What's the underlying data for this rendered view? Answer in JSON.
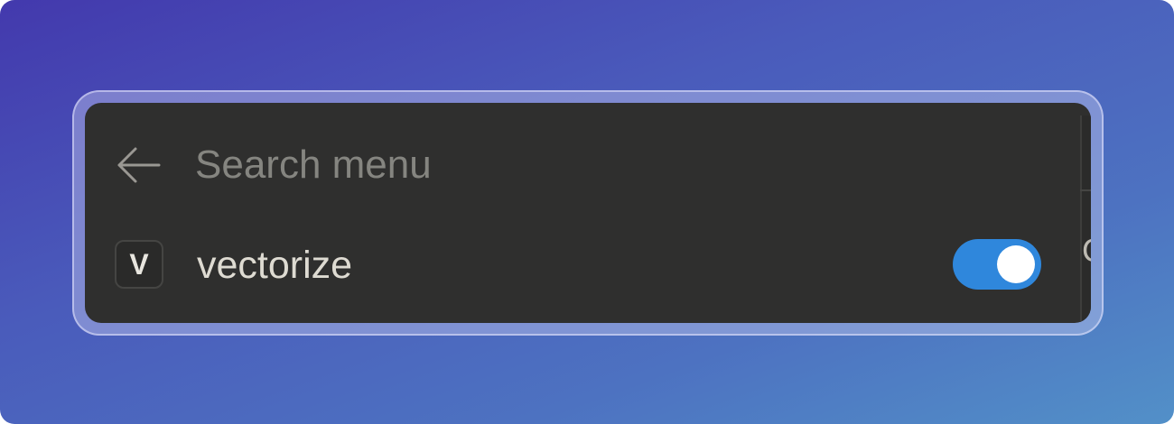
{
  "search": {
    "placeholder": "Search menu",
    "value": ""
  },
  "menu": {
    "items": [
      {
        "badge": "V",
        "label": "vectorize",
        "enabled": true
      }
    ]
  },
  "colors": {
    "panel": "#2f2f2e",
    "toggle_on": "#2f87dc",
    "text": "#dedbd2",
    "placeholder": "#858580"
  },
  "icons": {
    "back": "arrow-left-icon"
  }
}
